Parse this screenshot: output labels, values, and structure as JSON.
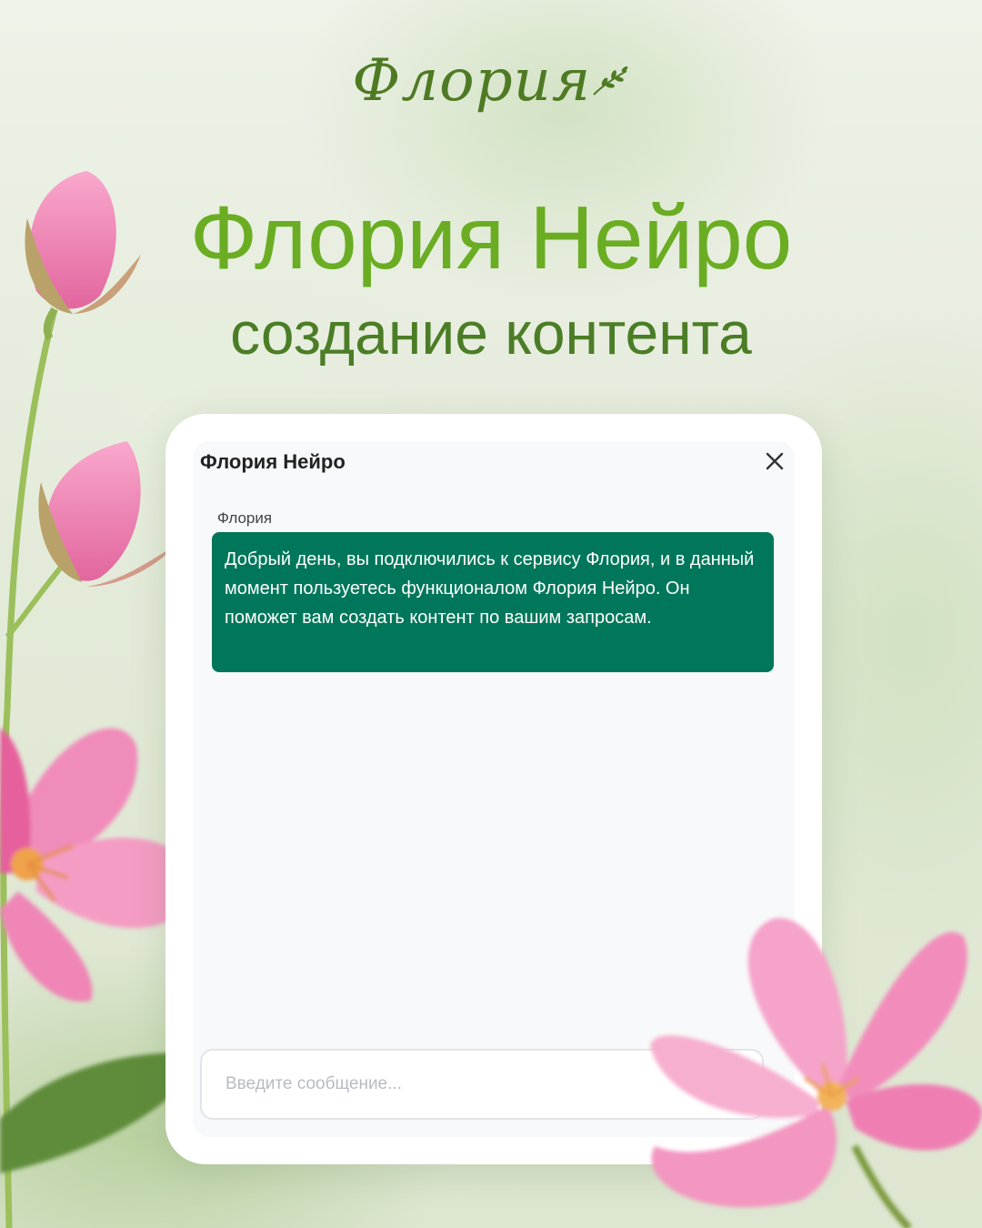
{
  "brand": {
    "logo_text": "Флория",
    "logo_icon": "leaf-sprig-icon"
  },
  "hero": {
    "title": "Флория Нейро",
    "subtitle": "создание контента"
  },
  "chat": {
    "window_title": "Флория Нейро",
    "close_icon": "close-icon",
    "messages": [
      {
        "sender": "Флория",
        "text": "Добрый день, вы подключились к сервису Флория, и в данный момент пользуетесь функционалом Флория Нейро. Он поможет вам создать контент по вашим запросам."
      }
    ],
    "input": {
      "placeholder": "Введите сообщение...",
      "value": ""
    }
  },
  "colors": {
    "brand_green": "#6aad22",
    "dark_green": "#4b7d26",
    "bubble": "#00775a",
    "petal_pink": "#f07fb0"
  }
}
